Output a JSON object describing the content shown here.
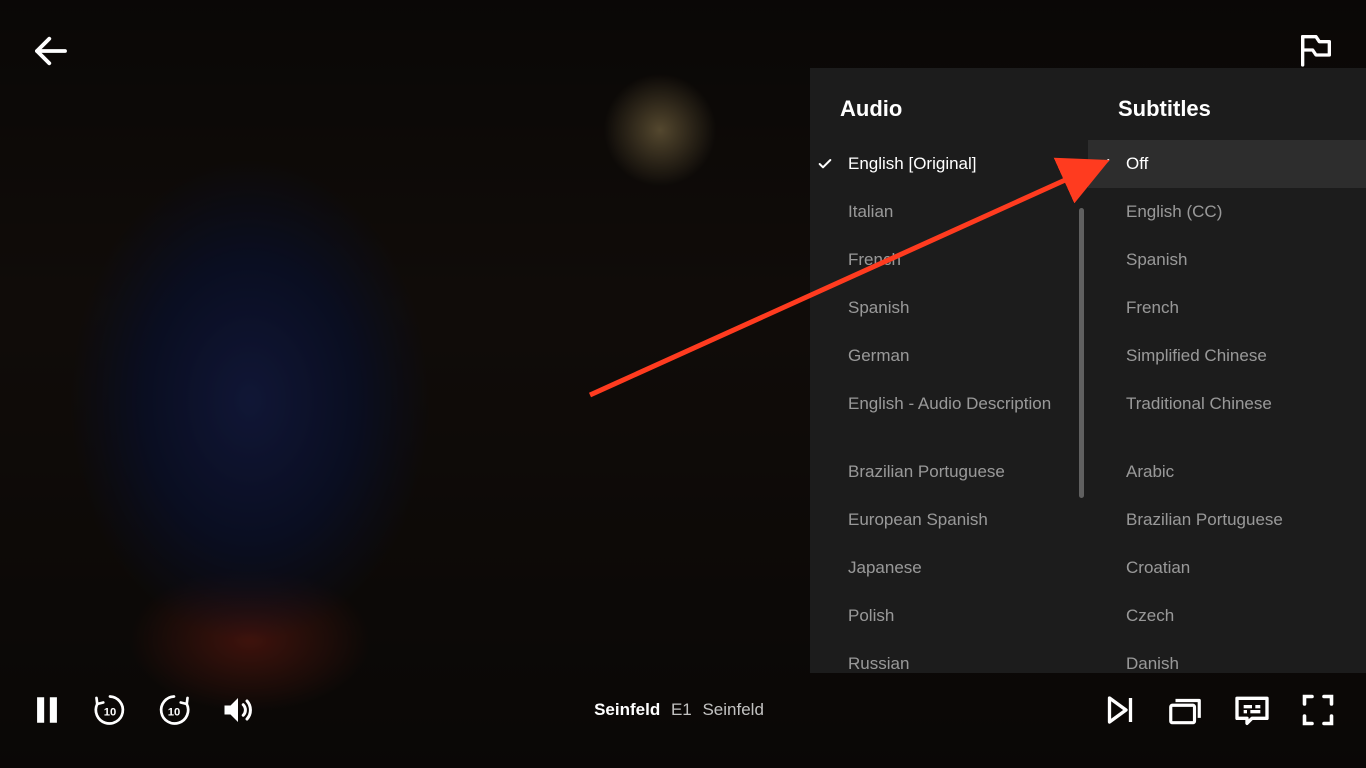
{
  "panel": {
    "audio": {
      "header": "Audio",
      "groups": [
        [
          {
            "label": "English [Original]",
            "selected": true
          },
          {
            "label": "Italian"
          },
          {
            "label": "French"
          },
          {
            "label": "Spanish"
          },
          {
            "label": "German"
          },
          {
            "label": "English - Audio Description"
          }
        ],
        [
          {
            "label": "Brazilian Portuguese"
          },
          {
            "label": "European Spanish"
          },
          {
            "label": "Japanese"
          },
          {
            "label": "Polish"
          },
          {
            "label": "Russian"
          }
        ]
      ]
    },
    "subtitles": {
      "header": "Subtitles",
      "groups": [
        [
          {
            "label": "Off",
            "selected": true,
            "highlight": true
          },
          {
            "label": "English (CC)"
          },
          {
            "label": "Spanish"
          },
          {
            "label": "French"
          },
          {
            "label": "Simplified Chinese"
          },
          {
            "label": "Traditional Chinese"
          }
        ],
        [
          {
            "label": "Arabic"
          },
          {
            "label": "Brazilian Portuguese"
          },
          {
            "label": "Croatian"
          },
          {
            "label": "Czech"
          },
          {
            "label": "Danish"
          }
        ]
      ]
    }
  },
  "playback": {
    "title": "Seinfeld",
    "episode": "E1",
    "episode_name": "Seinfeld"
  },
  "icons": {
    "back": "back-arrow-icon",
    "flag": "flag-icon",
    "pause": "pause-icon",
    "rewind10": "rewind-10-icon",
    "forward10": "forward-10-icon",
    "volume": "volume-icon",
    "next": "next-episode-icon",
    "episodes": "episodes-icon",
    "subtitles": "subtitles-icon",
    "fullscreen": "fullscreen-icon"
  },
  "colors": {
    "panel_bg": "#1e1e1e",
    "text_primary": "#ffffff",
    "text_secondary": "rgba(255,255,255,0.55)",
    "annotation_arrow": "#ff3b1f"
  }
}
